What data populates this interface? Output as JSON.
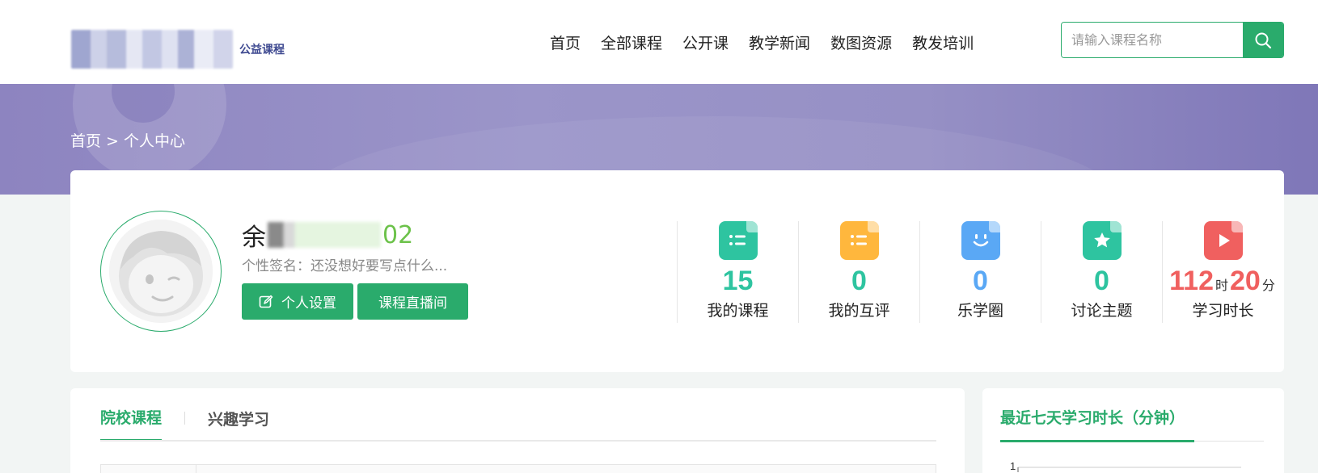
{
  "header": {
    "logo_text": "公益课程",
    "nav": [
      "首页",
      "全部课程",
      "公开课",
      "教学新闻",
      "数图资源",
      "教发培训"
    ],
    "search_placeholder": "请输入课程名称",
    "accent_color": "#2aab6c"
  },
  "banner": {
    "breadcrumb": "首页 > 个人中心"
  },
  "profile": {
    "name_prefix": "余",
    "name_suffix": "02",
    "signature": "个性签名：还没想好要写点什么...",
    "settings_button": "个人设置",
    "live_button": "课程直播间"
  },
  "stats": [
    {
      "value": "15",
      "label": "我的课程",
      "icon": "list-doc-icon",
      "color": "#2ec4a0"
    },
    {
      "value": "0",
      "label": "我的互评",
      "icon": "list-doc-icon",
      "color": "#ffb73d"
    },
    {
      "value": "0",
      "label": "乐学圈",
      "icon": "smile-doc-icon",
      "color": "#5aa8f5"
    },
    {
      "value": "0",
      "label": "讨论主题",
      "icon": "star-doc-icon",
      "color": "#2ec4a0"
    }
  ],
  "study_time": {
    "hours": "112",
    "hour_unit": "时",
    "minutes": "20",
    "minute_unit": "分",
    "label": "学习时长",
    "color": "#f0605f"
  },
  "course_tabs": [
    "院校课程",
    "兴趣学习"
  ],
  "chart": {
    "title": "最近七天学习时长（分钟）",
    "y_tick_top": "1"
  }
}
